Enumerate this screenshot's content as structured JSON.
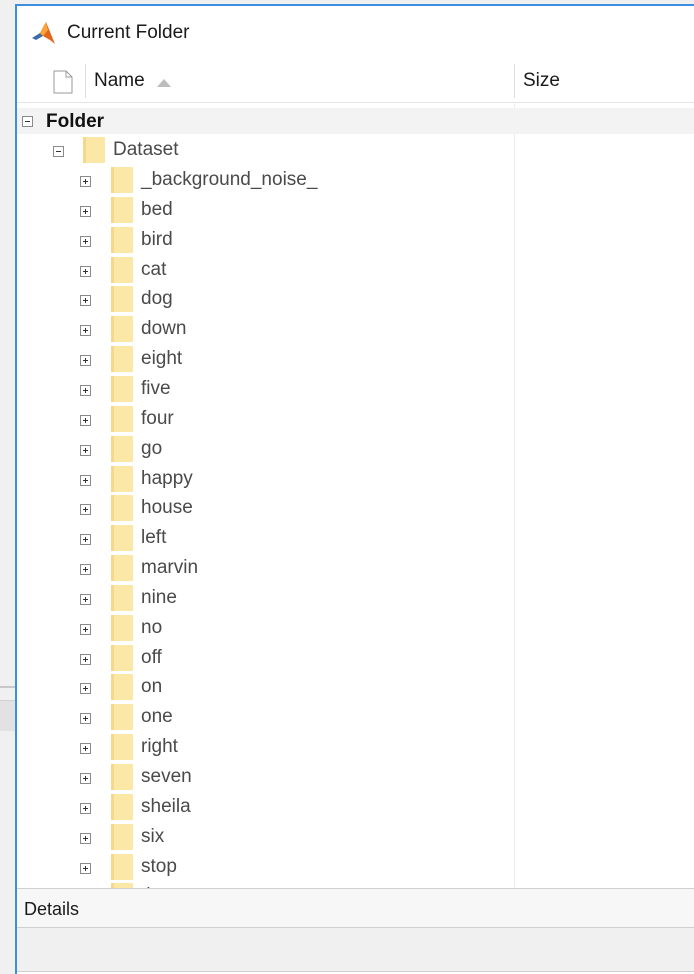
{
  "panel": {
    "title": "Current Folder",
    "columns": {
      "name": "Name",
      "size": "Size"
    },
    "details_label": "Details"
  },
  "tree": {
    "root": {
      "label": "Folder",
      "expanded": true
    },
    "dataset": {
      "label": "Dataset",
      "expanded": true
    },
    "folders": [
      "_background_noise_",
      "bed",
      "bird",
      "cat",
      "dog",
      "down",
      "eight",
      "five",
      "four",
      "go",
      "happy",
      "house",
      "left",
      "marvin",
      "nine",
      "no",
      "off",
      "on",
      "one",
      "right",
      "seven",
      "sheila",
      "six",
      "stop",
      "th"
    ]
  },
  "icons": {
    "app_logo": "matlab-logo-icon",
    "file_column": "file-icon",
    "sort": "sort-ascending-icon",
    "folder": "folder-icon",
    "expand": "plus-box-icon",
    "collapse": "minus-box-icon"
  },
  "colors": {
    "panel_border": "#3c8fde",
    "folder": "#fbe7a6",
    "text": "#4a4a4a"
  }
}
